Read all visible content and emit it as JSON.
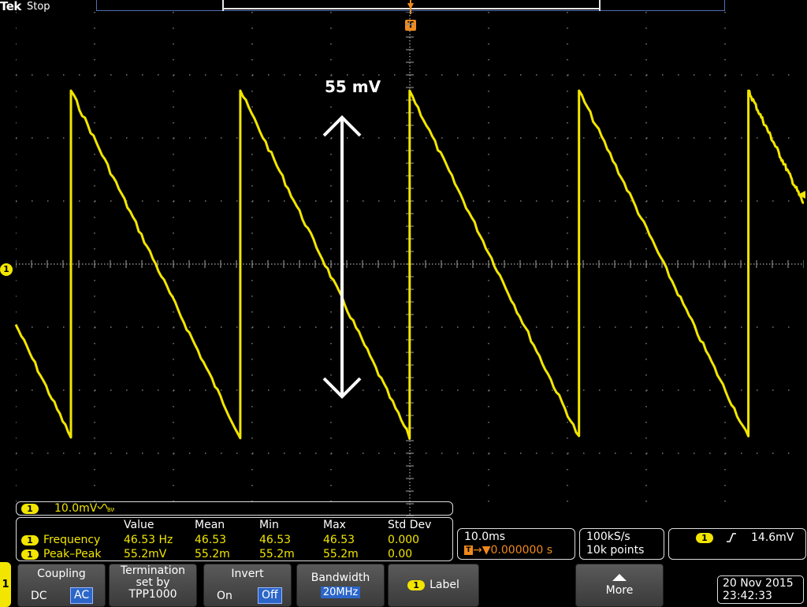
{
  "header": {
    "brand": "Tek",
    "acquisition_state": "Stop"
  },
  "markers": {
    "trigger_label": "T",
    "channel_label": "1"
  },
  "annotation": {
    "text": "55 mV"
  },
  "channel1": {
    "badge": "1",
    "scale": "10.0mV",
    "color": "#f2e600"
  },
  "measurements": {
    "headers": [
      "Value",
      "Mean",
      "Min",
      "Max",
      "Std Dev"
    ],
    "rows": [
      {
        "name": "Frequency",
        "value": "46.53 Hz",
        "mean": "46.53",
        "min": "46.53",
        "max": "46.53",
        "std_dev": "0.000"
      },
      {
        "name": "Peak–Peak",
        "value": "55.2mV",
        "mean": "55.2m",
        "min": "55.2m",
        "max": "55.2m",
        "std_dev": "0.00"
      }
    ]
  },
  "timebase": {
    "scale": "10.0ms",
    "delay": "0.000000 s"
  },
  "acquisition": {
    "sample_rate": "100kS/s",
    "record_length": "10k points"
  },
  "trigger": {
    "source": "1",
    "level": "14.6mV",
    "color": "#f08a1c"
  },
  "menu": {
    "channel": "1",
    "coupling": {
      "title": "Coupling",
      "options": [
        "DC",
        "AC"
      ],
      "selected": "AC"
    },
    "termination": {
      "line1": "Termination",
      "line2": "set by",
      "line3": "TPP1000"
    },
    "invert": {
      "title": "Invert",
      "options": [
        "On",
        "Off"
      ],
      "selected": "Off"
    },
    "bandwidth": {
      "title": "Bandwidth",
      "value": "20MHz"
    },
    "label": {
      "title": "Label"
    },
    "more": {
      "title": "More"
    }
  },
  "datetime": {
    "date": "20 Nov 2015",
    "time": "23:42:33"
  },
  "waveform": {
    "type": "sawtooth",
    "period_divisions": 2.149,
    "peak_to_peak_divisions": 5.5,
    "offset_divisions": 0
  }
}
